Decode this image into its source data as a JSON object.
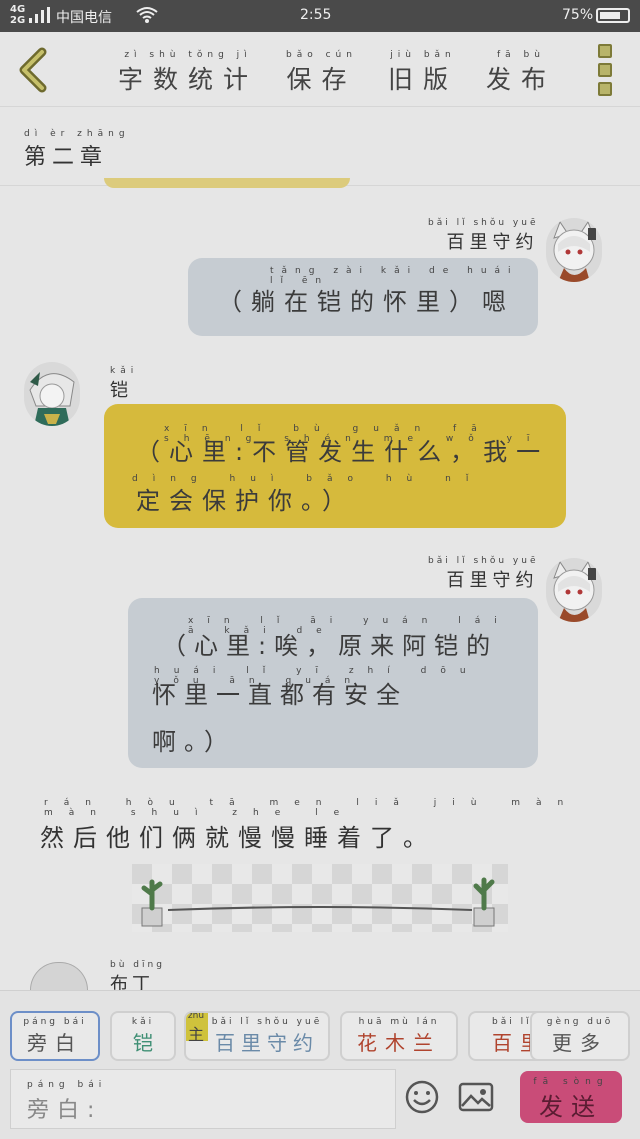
{
  "status": {
    "network": "4G\n2G",
    "carrier": "中国电信",
    "time": "2:55",
    "battery": "75%",
    "battery_level": 0.75
  },
  "header": {
    "word_count": {
      "pinyin": "zì shù tǒng jì",
      "label": "字数统计"
    },
    "save": {
      "pinyin": "bǎo cún",
      "label": "保存"
    },
    "old_version": {
      "pinyin": "jiù bǎn",
      "label": "旧版"
    },
    "publish": {
      "pinyin": "fā bù",
      "label": "发布"
    }
  },
  "chapter": {
    "pinyin": "dì èr zhāng",
    "title": "第二章"
  },
  "messages": [
    {
      "speaker_pinyin": "bǎi lǐ shǒu yuē",
      "speaker": "百里守约",
      "pinyin": "tǎng zài kǎi de huái lǐ ēn",
      "lines": [
        "（躺在铠的怀里）嗯"
      ]
    },
    {
      "speaker_pinyin": "kǎi",
      "speaker": "铠",
      "pinyin1": "xīn lǐ bù guǎn fā shēng shén me wǒ yī",
      "pinyin2": "dìng huì bǎo hù nǐ",
      "lines": [
        "（心里:不管发生什么，我一",
        "定会保护你。）"
      ]
    },
    {
      "speaker_pinyin": "bǎi lǐ shǒu yuē",
      "speaker": "百里守约",
      "pinyin1": "xīn lǐ āi yuán lái ā kǎi de",
      "pinyin2": "huái lǐ yī zhí dōu yǒu ān quán",
      "lines": [
        "（心里:唉，原来阿铠的",
        "怀里一直都有安全",
        "啊。）"
      ]
    }
  ],
  "narration": {
    "pinyin": "rán hòu tā men liǎ jiù màn màn shuì zhe le",
    "text": "然后他们俩就慢慢睡着了。"
  },
  "partial_speaker": {
    "pinyin": "bù dīng",
    "name": "布丁"
  },
  "roles": [
    {
      "pinyin": "páng bái",
      "label": "旁白",
      "color": "#555555"
    },
    {
      "pinyin": "kǎi",
      "label": "铠",
      "color": "#3f8f74"
    },
    {
      "tag": "主",
      "tag_pinyin": "zhǔ",
      "pinyin": "bǎi lǐ shǒu yuē",
      "label": "百里守约",
      "color": "#6a8aa8"
    },
    {
      "pinyin": "huā mù lán",
      "label": "花木兰",
      "color": "#b0442e"
    },
    {
      "pinyin": "bǎi lǐ",
      "label": "百里",
      "color": "#b0442e"
    },
    {
      "pinyin": "gèng duō",
      "label": "更多",
      "color": "#555555"
    }
  ],
  "input": {
    "pinyin": "páng bái",
    "placeholder": "旁白:"
  },
  "send": {
    "pinyin": "fā sòng",
    "label": "发送"
  },
  "colors": {
    "bubble_blue": "#c6ccd2",
    "bubble_yellow": "#d6ba3c",
    "send": "#c94c78",
    "header_icon": "#b8b46a"
  }
}
